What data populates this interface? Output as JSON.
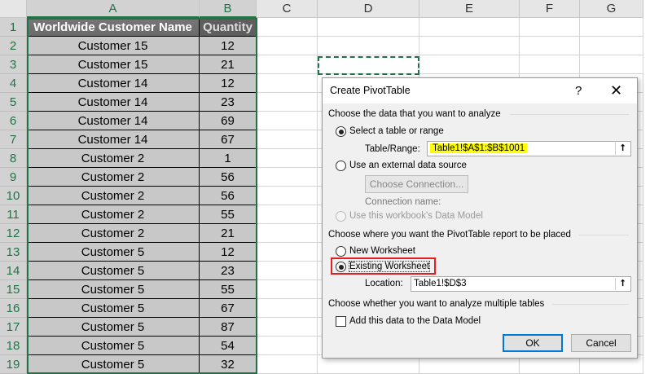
{
  "columns": [
    "A",
    "B",
    "C",
    "D",
    "E",
    "F",
    "G"
  ],
  "rows": [
    "1",
    "2",
    "3",
    "4",
    "5",
    "6",
    "7",
    "8",
    "9",
    "10",
    "11",
    "12",
    "13",
    "14",
    "15",
    "16",
    "17",
    "18",
    "19"
  ],
  "table": {
    "headers": [
      "Worldwide Customer Name",
      "Quantity"
    ],
    "data": [
      [
        "Customer 15",
        "12"
      ],
      [
        "Customer 15",
        "21"
      ],
      [
        "Customer 14",
        "12"
      ],
      [
        "Customer 14",
        "23"
      ],
      [
        "Customer 14",
        "69"
      ],
      [
        "Customer 14",
        "67"
      ],
      [
        "Customer 2",
        "1"
      ],
      [
        "Customer 2",
        "56"
      ],
      [
        "Customer 2",
        "56"
      ],
      [
        "Customer 2",
        "55"
      ],
      [
        "Customer 2",
        "21"
      ],
      [
        "Customer 5",
        "12"
      ],
      [
        "Customer 5",
        "23"
      ],
      [
        "Customer 5",
        "55"
      ],
      [
        "Customer 5",
        "67"
      ],
      [
        "Customer 5",
        "87"
      ],
      [
        "Customer 5",
        "54"
      ],
      [
        "Customer 5",
        "32"
      ]
    ]
  },
  "dialog": {
    "title": "Create PivotTable",
    "help": "?",
    "close": "✕",
    "section1": "Choose the data that you want to analyze",
    "opt_select": "Select a table or range",
    "range_label": "Table/Range:",
    "range_value": "Table1!$A$1:$B$1001",
    "opt_external": "Use an external data source",
    "choose_connection": "Choose Connection...",
    "connection_name": "Connection name:",
    "opt_datamodel": "Use this workbook's Data Model",
    "section2": "Choose where you want the PivotTable report to be placed",
    "opt_new": "New Worksheet",
    "opt_existing": "Existing Worksheet",
    "location_label": "Location:",
    "location_value": "Table1!$D$3",
    "section3": "Choose whether you want to analyze multiple tables",
    "add_model": "Add this data to the Data Model",
    "ok": "OK",
    "cancel": "Cancel",
    "collapse_icon": "⭡"
  },
  "colors": {
    "accent": "#217346",
    "highlight": "#ffff00",
    "focus": "#0078d7",
    "callout": "#e02020"
  }
}
